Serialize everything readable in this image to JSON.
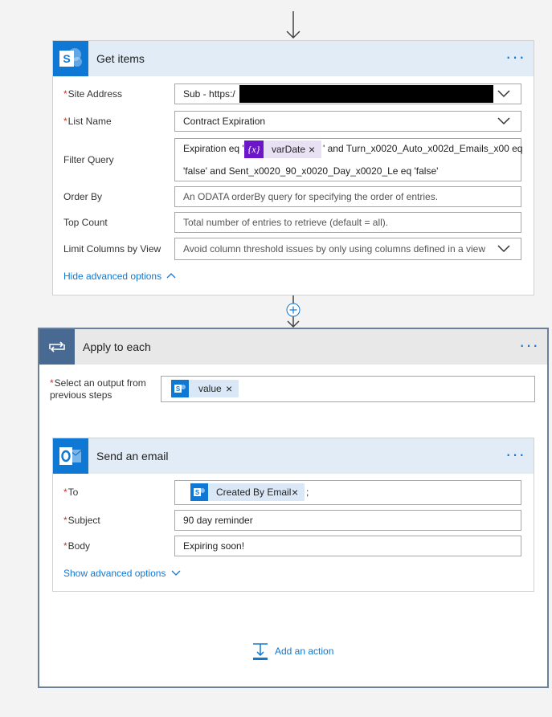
{
  "get_items": {
    "title": "Get items",
    "more_label": "···",
    "icon": "sharepoint-icon",
    "fields": {
      "site_address": {
        "label": "Site Address",
        "value": "Sub - https:/"
      },
      "list_name": {
        "label": "List Name",
        "value": "Contract Expiration"
      },
      "filter_query": {
        "label": "Filter Query",
        "prefix": "Expiration eq '",
        "token_label": "varDate",
        "suffix": "' and Turn_x0020_Auto_x002d_Emails_x00 eq",
        "line2": "'false' and Sent_x0020_90_x0020_Day_x0020_Le eq 'false'"
      },
      "order_by": {
        "label": "Order By",
        "placeholder": "An ODATA orderBy query for specifying the order of entries."
      },
      "top_count": {
        "label": "Top Count",
        "placeholder": "Total number of entries to retrieve (default = all)."
      },
      "limit_columns": {
        "label": "Limit Columns by View",
        "placeholder": "Avoid column threshold issues by only using columns defined in a view"
      }
    },
    "advanced_link": "Hide advanced options"
  },
  "apply_to_each": {
    "title": "Apply to each",
    "more_label": "···",
    "icon": "loop-icon",
    "select_label_line1": "Select an output from",
    "select_label_line2": "previous steps",
    "token_label": "value"
  },
  "send_email": {
    "title": "Send an email",
    "more_label": "···",
    "icon": "outlook-icon",
    "to": {
      "label": "To",
      "token_label": "Created By Email",
      "suffix": ";"
    },
    "subject": {
      "label": "Subject",
      "value": "90 day reminder"
    },
    "body": {
      "label": "Body",
      "value": "Expiring soon!"
    },
    "advanced_link": "Show advanced options"
  },
  "add_action": {
    "label": "Add an action"
  },
  "colors": {
    "accent": "#0f78d4",
    "header_bg": "#e1ecf7",
    "variable_purple": "#6b16c8",
    "required": "#c0362c"
  }
}
